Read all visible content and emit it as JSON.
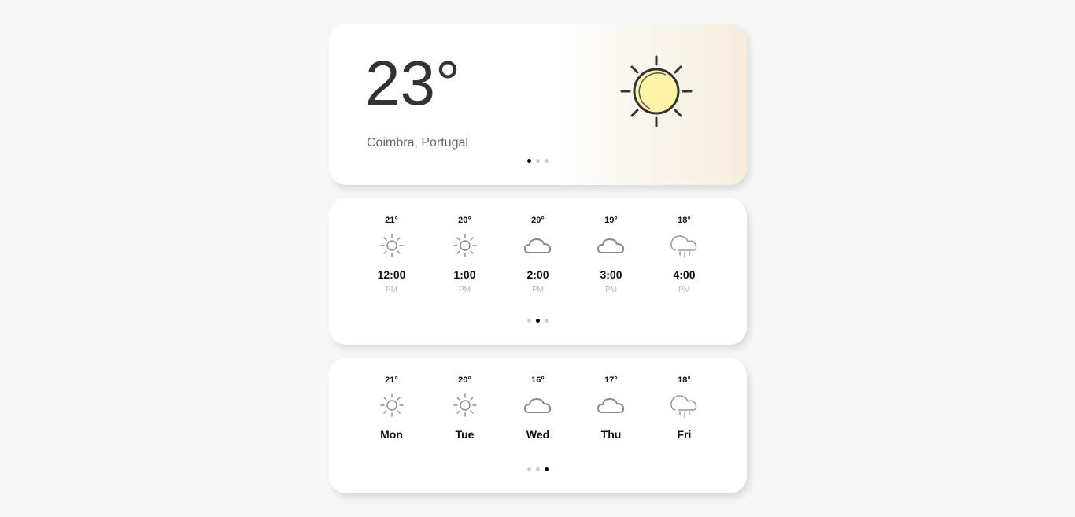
{
  "current": {
    "temperature": "23°",
    "location": "Coimbra, Portugal",
    "icon": "sun-icon",
    "page_dots": {
      "count": 3,
      "active": 0
    }
  },
  "hourly": {
    "items": [
      {
        "temp": "21°",
        "icon": "sun",
        "time": "12:00",
        "period": "PM"
      },
      {
        "temp": "20°",
        "icon": "sun",
        "time": "1:00",
        "period": "PM"
      },
      {
        "temp": "20°",
        "icon": "cloud",
        "time": "2:00",
        "period": "PM"
      },
      {
        "temp": "19°",
        "icon": "cloud",
        "time": "3:00",
        "period": "PM"
      },
      {
        "temp": "18°",
        "icon": "rain",
        "time": "4:00",
        "period": "PM"
      }
    ],
    "page_dots": {
      "count": 3,
      "active": 1
    }
  },
  "daily": {
    "items": [
      {
        "temp": "21°",
        "icon": "sun",
        "day": "Mon"
      },
      {
        "temp": "20°",
        "icon": "sun",
        "day": "Tue"
      },
      {
        "temp": "16°",
        "icon": "cloud",
        "day": "Wed"
      },
      {
        "temp": "17°",
        "icon": "cloud",
        "day": "Thu"
      },
      {
        "temp": "18°",
        "icon": "rain",
        "day": "Fri"
      }
    ],
    "page_dots": {
      "count": 3,
      "active": 2
    }
  },
  "colors": {
    "sun_fill": "#fdf3a6",
    "icon_gray": "#8a8a8a",
    "dot_active": "#000000",
    "dot_inactive": "#cfcfcf"
  }
}
